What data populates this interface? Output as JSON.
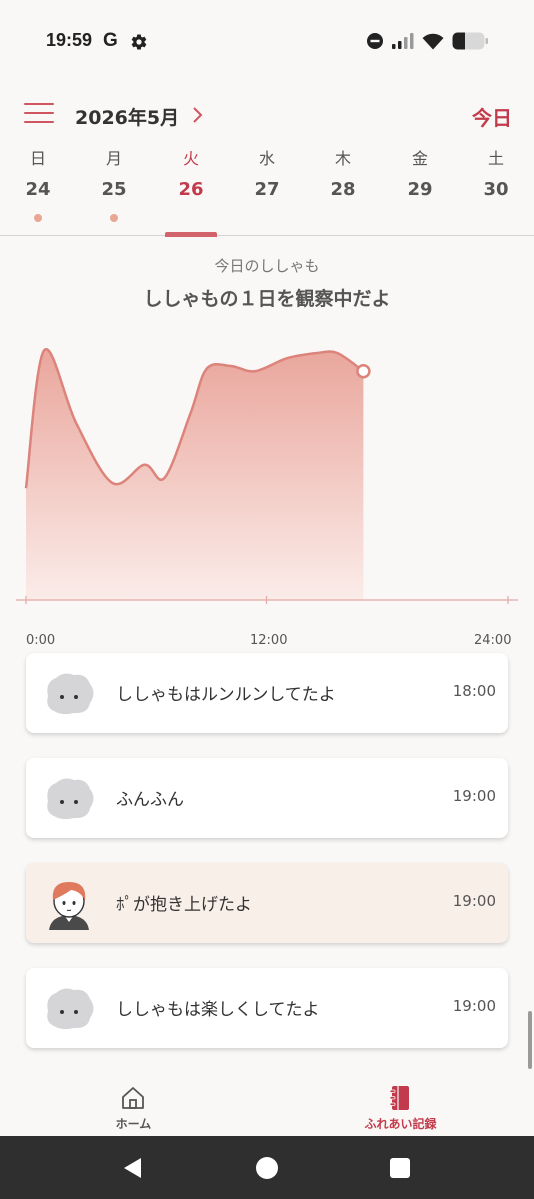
{
  "status_bar": {
    "time": "19:59",
    "google_letter": "G",
    "icons": [
      "settings-gear-icon",
      "do-not-disturb-icon",
      "signal-icon",
      "wifi-icon",
      "battery-icon"
    ]
  },
  "header": {
    "month_title": "2026年5月",
    "next_icon": "chevron-right-icon",
    "menu_icon": "hamburger-menu-icon",
    "today_label": "今日"
  },
  "week": {
    "days": [
      {
        "dow": "日",
        "num": "24",
        "has_dot": true,
        "selected": false
      },
      {
        "dow": "月",
        "num": "25",
        "has_dot": true,
        "selected": false
      },
      {
        "dow": "火",
        "num": "26",
        "has_dot": false,
        "selected": true
      },
      {
        "dow": "水",
        "num": "27",
        "has_dot": false,
        "selected": false
      },
      {
        "dow": "木",
        "num": "28",
        "has_dot": false,
        "selected": false
      },
      {
        "dow": "金",
        "num": "29",
        "has_dot": false,
        "selected": false
      },
      {
        "dow": "土",
        "num": "30",
        "has_dot": false,
        "selected": false
      }
    ]
  },
  "summary": {
    "subtitle": "今日のししゃも",
    "title": "ししゃもの１日を観察中だよ"
  },
  "chart_data": {
    "type": "area",
    "x_tick_labels": [
      "0:00",
      "12:00",
      "24:00"
    ],
    "xlim": [
      0,
      24
    ],
    "x": [
      0,
      0.9,
      2.5,
      4.3,
      5.9,
      6.9,
      8.2,
      9.0,
      10.2,
      11.4,
      13.0,
      14.5,
      15.5,
      16.8
    ],
    "y": [
      43,
      96,
      68,
      45,
      52,
      47,
      72,
      89,
      90,
      88,
      93,
      95,
      95,
      88
    ],
    "ylim": [
      0,
      100
    ],
    "grid": false,
    "colors": {
      "line": "#dc837b",
      "fill_top": "#e9a69c",
      "fill_bottom": "#fbece9",
      "axis": "#e4a9a6"
    }
  },
  "records": [
    {
      "avatar": "shishamo-fluffy-avatar",
      "text": "ししゃもはルンルンしてたよ",
      "time": "18:00",
      "highlight": false
    },
    {
      "avatar": "shishamo-fluffy-avatar",
      "text": "ふんふん",
      "time": "19:00",
      "highlight": false
    },
    {
      "avatar": "person-avatar",
      "text": "ﾎﾟが抱き上げたよ",
      "time": "19:00",
      "highlight": true
    },
    {
      "avatar": "shishamo-fluffy-avatar",
      "text": "ししゃもは楽しくしてたよ",
      "time": "19:00",
      "highlight": false
    }
  ],
  "bottom_nav": {
    "home": {
      "label": "ホーム",
      "icon": "home-icon",
      "color": "#555555"
    },
    "records": {
      "label": "ふれあい記録",
      "icon": "notebook-icon",
      "color": "#c23b4c",
      "active": true
    }
  },
  "system_nav": {
    "icons": [
      "back-triangle-icon",
      "home-circle-icon",
      "recents-square-icon"
    ]
  }
}
